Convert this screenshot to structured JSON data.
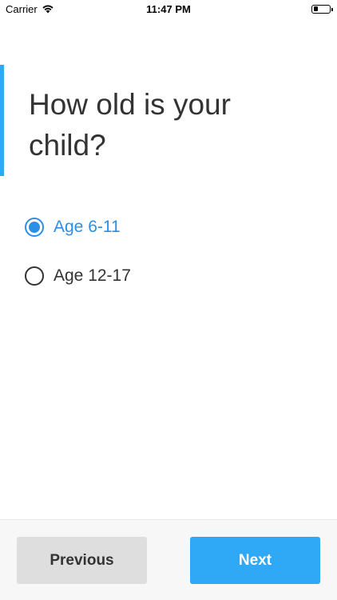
{
  "status_bar": {
    "carrier": "Carrier",
    "time": "11:47 PM",
    "battery_level_percent": 30,
    "icons": [
      "wifi-icon",
      "battery-icon"
    ]
  },
  "question": {
    "text": "How old is your child?",
    "accent_color": "#2fa8f5"
  },
  "options": [
    {
      "label": "Age 6-11",
      "selected": true
    },
    {
      "label": "Age 12-17",
      "selected": false
    }
  ],
  "colors": {
    "selected": "#2b8fe8",
    "primary_button": "#2fa8f5",
    "secondary_button": "#dedede"
  },
  "footer": {
    "previous_label": "Previous",
    "next_label": "Next"
  }
}
